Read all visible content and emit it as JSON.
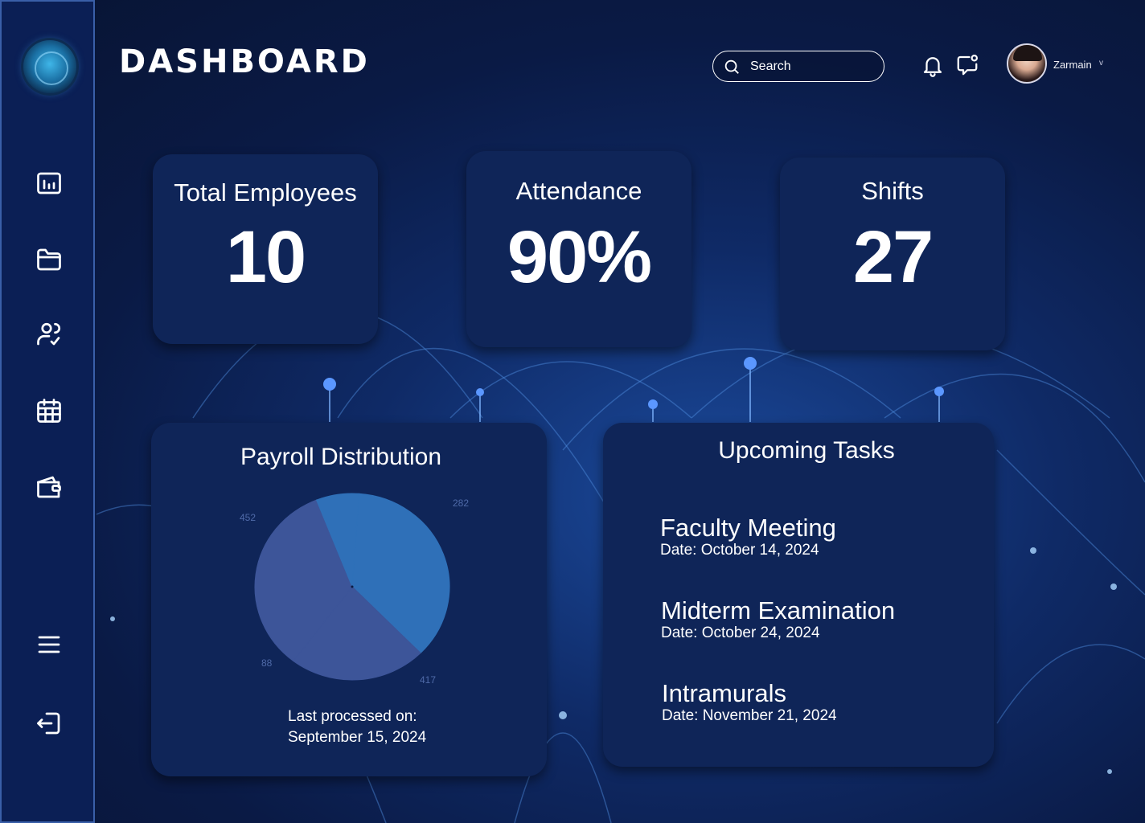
{
  "header": {
    "title": "DASHBOARD",
    "search_placeholder": "Search",
    "user_name": "Zarmain",
    "user_caret": "v"
  },
  "sidebar": {
    "items": [
      {
        "icon": "bar-chart-icon"
      },
      {
        "icon": "folder-icon"
      },
      {
        "icon": "user-check-icon"
      },
      {
        "icon": "calendar-icon"
      },
      {
        "icon": "wallet-icon"
      },
      {
        "icon": "menu-icon"
      },
      {
        "icon": "logout-icon"
      }
    ]
  },
  "stats": {
    "employees": {
      "label": "Total Employees",
      "value": "10"
    },
    "attendance": {
      "label": "Attendance",
      "value": "90%"
    },
    "shifts": {
      "label": "Shifts",
      "value": "27"
    }
  },
  "payroll": {
    "title": "Payroll Distribution",
    "processed_label": "Last processed on:",
    "processed_date": "September 15, 2024"
  },
  "chart_data": {
    "type": "pie",
    "title": "Payroll Distribution",
    "slices": [
      {
        "value": 452,
        "color": "#2f70b8"
      },
      {
        "value": 282,
        "color": "#3d5599"
      },
      {
        "value": 417,
        "color": "#3d5599"
      },
      {
        "value": 88,
        "color": "#2f70b8"
      }
    ],
    "labels": [
      "452",
      "282",
      "417",
      "88"
    ]
  },
  "tasks": {
    "title": "Upcoming Tasks",
    "items": [
      {
        "title": "Faculty Meeting",
        "date": "Date: October 14, 2024"
      },
      {
        "title": "Midterm Examination",
        "date": "Date: October 24, 2024"
      },
      {
        "title": "Intramurals",
        "date": "Date: November 21, 2024"
      }
    ]
  },
  "colors": {
    "sidebar": "#0b1f55",
    "card": "#0f2558",
    "pie_light": "#2f70b8",
    "pie_dark": "#3d5599"
  }
}
